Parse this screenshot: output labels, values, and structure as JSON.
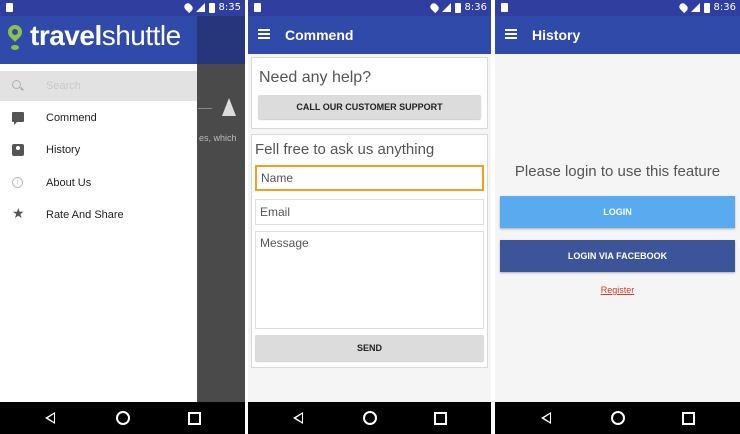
{
  "status": {
    "time_panel1": "8:35",
    "time_panel2": "8:36",
    "time_panel3": "8:36"
  },
  "drawer": {
    "logo_part1": "travel",
    "logo_part2": "shuttle",
    "search_placeholder": "Search",
    "items": [
      {
        "label": "Commend",
        "icon": "comment-icon"
      },
      {
        "label": "History",
        "icon": "history-icon"
      },
      {
        "label": "About Us",
        "icon": "info-icon"
      },
      {
        "label": "Rate And Share",
        "icon": "star-icon"
      }
    ],
    "background_snippet": "es, which"
  },
  "commend": {
    "title": "Commend",
    "help_heading": "Need any help?",
    "support_button": "CALL OUR CUSTOMER SUPPORT",
    "ask_heading": "Fell free to ask us anything",
    "name_placeholder": "Name",
    "email_placeholder": "Email",
    "message_placeholder": "Message",
    "send_button": "SEND"
  },
  "history": {
    "title": "History",
    "message": "Please login to use this feature",
    "login_button": "LOGIN",
    "facebook_button": "LOGIN VIA FACEBOOK",
    "register_link": "Register"
  },
  "colors": {
    "appbar": "#2f4aa8",
    "login": "#5aaaf0",
    "facebook": "#3b5598",
    "focus": "#f0a020",
    "link": "#d53b2f"
  }
}
